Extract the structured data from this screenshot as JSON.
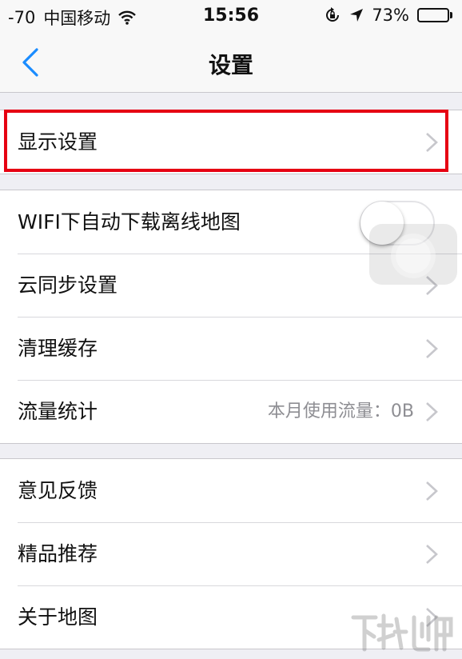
{
  "status_bar": {
    "signal": "-70",
    "carrier": "中国移动",
    "time": "15:56",
    "battery_percent": "73%",
    "battery_level": 0.73,
    "icons": [
      "wifi-icon",
      "orientation-lock-icon",
      "location-arrow-icon",
      "battery-icon"
    ]
  },
  "nav": {
    "title": "设置",
    "back_icon": "chevron-left-icon"
  },
  "groups": [
    {
      "items": [
        {
          "label": "显示设置",
          "accessory": "chevron"
        }
      ]
    },
    {
      "items": [
        {
          "label": "WIFI下自动下载离线地图",
          "accessory": "toggle",
          "toggle_on": false
        },
        {
          "label": "云同步设置",
          "accessory": "chevron"
        },
        {
          "label": "清理缓存",
          "accessory": "chevron"
        },
        {
          "label": "流量统计",
          "value": "本月使用流量：0B",
          "accessory": "chevron"
        }
      ]
    },
    {
      "items": [
        {
          "label": "意见反馈",
          "accessory": "chevron"
        },
        {
          "label": "精品推荐",
          "accessory": "chevron"
        },
        {
          "label": "关于地图",
          "accessory": "chevron"
        }
      ]
    }
  ],
  "colors": {
    "accent": "#1a8cff",
    "highlight": "#e60012",
    "background": "#efeff4",
    "secondary_text": "#8e8e93"
  }
}
